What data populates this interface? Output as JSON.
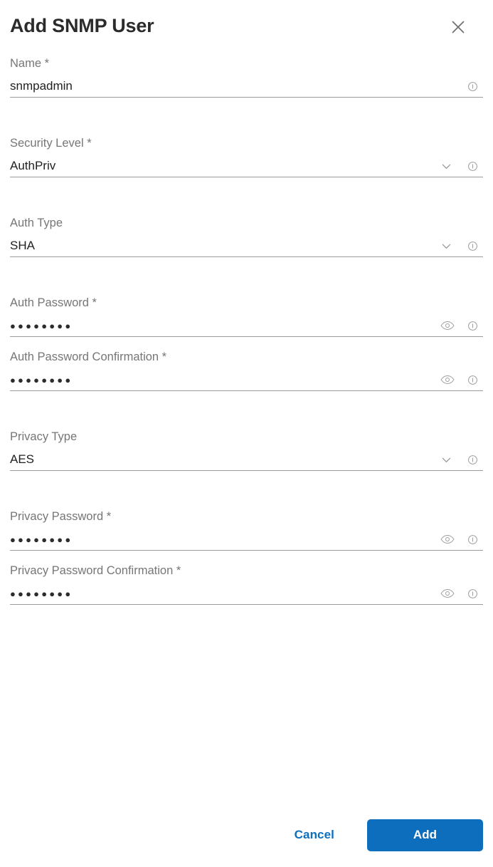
{
  "dialog": {
    "title": "Add SNMP User",
    "close_icon": "close-icon"
  },
  "fields": [
    {
      "label": "Name *",
      "value": "snmpadmin",
      "type": "text",
      "name": "name",
      "has_chevron": false,
      "has_eye": false,
      "has_info": true
    },
    {
      "label": "Security Level *",
      "value": "AuthPriv",
      "type": "select",
      "name": "security-level",
      "has_chevron": true,
      "has_eye": false,
      "has_info": true
    },
    {
      "label": "Auth Type",
      "value": "SHA",
      "type": "select",
      "name": "auth-type",
      "has_chevron": true,
      "has_eye": false,
      "has_info": true
    },
    {
      "label": "Auth Password *",
      "value": "●●●●●●●●",
      "type": "password",
      "name": "auth-password",
      "has_chevron": false,
      "has_eye": true,
      "has_info": true
    },
    {
      "label": "Auth Password Confirmation *",
      "value": "●●●●●●●●",
      "type": "password",
      "name": "auth-password-confirmation",
      "has_chevron": false,
      "has_eye": true,
      "has_info": true
    },
    {
      "label": "Privacy Type",
      "value": "AES",
      "type": "select",
      "name": "privacy-type",
      "has_chevron": true,
      "has_eye": false,
      "has_info": true
    },
    {
      "label": "Privacy Password *",
      "value": "●●●●●●●●",
      "type": "password",
      "name": "privacy-password",
      "has_chevron": false,
      "has_eye": true,
      "has_info": true
    },
    {
      "label": "Privacy Password Confirmation *",
      "value": "●●●●●●●●",
      "type": "password",
      "name": "privacy-password-confirmation",
      "has_chevron": false,
      "has_eye": true,
      "has_info": true
    }
  ],
  "footer": {
    "cancel_label": "Cancel",
    "add_label": "Add"
  },
  "colors": {
    "accent": "#0d6ebd",
    "label": "#767676",
    "value": "#212121",
    "title": "#2b2b2b",
    "underline": "#9b9b9b",
    "icon": "#9e9e9e"
  }
}
